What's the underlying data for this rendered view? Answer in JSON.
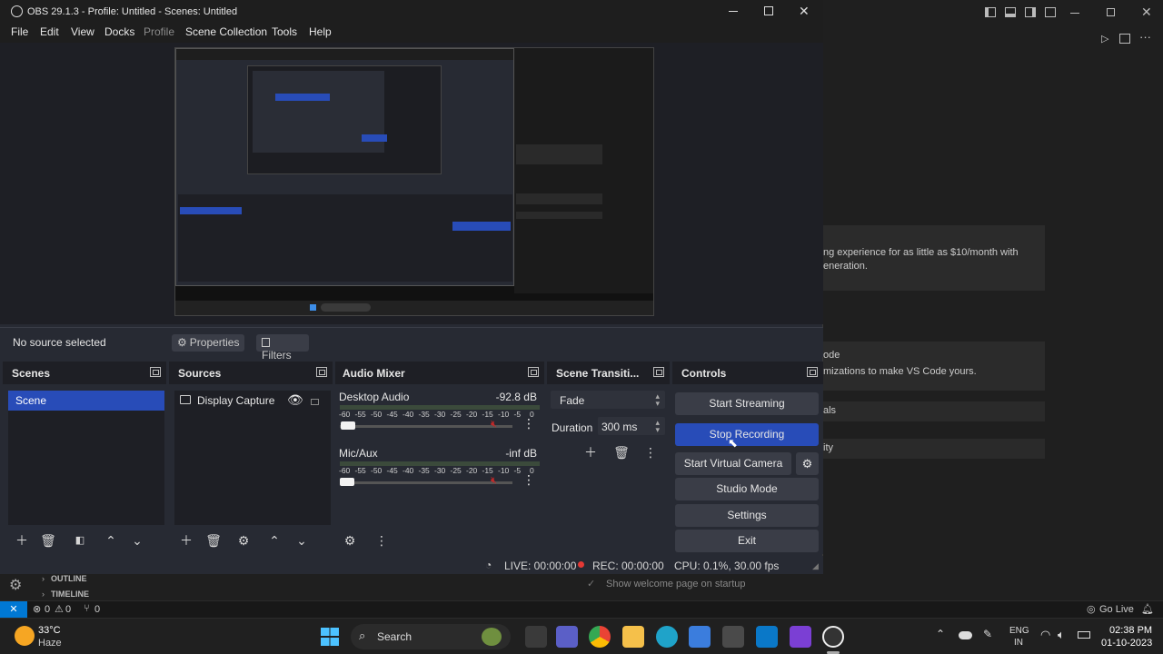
{
  "vscode": {
    "cards": [
      {
        "line1": "ng experience for as little as $10/month with",
        "line2": "eneration."
      },
      {
        "line1": "ode",
        "line2": "mizations to make VS Code yours."
      }
    ],
    "strips": [
      "als",
      "ity"
    ],
    "sidebar": {
      "outline": "OUTLINE",
      "timeline": "TIMELINE"
    },
    "welcome_checkbox_label": "Show welcome page on startup",
    "statusbar": {
      "errors": "0",
      "warnings": "0",
      "ports": "0",
      "go_live": "Go Live"
    }
  },
  "obs": {
    "title": "OBS 29.1.3 - Profile: Untitled - Scenes: Untitled",
    "menu": [
      "File",
      "Edit",
      "View",
      "Docks",
      "Profile",
      "Scene Collection",
      "Tools",
      "Help"
    ],
    "source_bar": {
      "status": "No source selected",
      "properties": "Properties",
      "filters": "Filters"
    },
    "scenes": {
      "title": "Scenes",
      "items": [
        "Scene"
      ]
    },
    "sources": {
      "title": "Sources",
      "items": [
        "Display Capture"
      ]
    },
    "mixer": {
      "title": "Audio Mixer",
      "tracks": [
        {
          "name": "Desktop Audio",
          "level": "-92.8 dB",
          "volume": 0.05
        },
        {
          "name": "Mic/Aux",
          "level": "-inf dB",
          "volume": 0.04
        }
      ],
      "scale": [
        "-60",
        "-55",
        "-50",
        "-45",
        "-40",
        "-35",
        "-30",
        "-25",
        "-20",
        "-15",
        "-10",
        "-5",
        "0"
      ]
    },
    "transitions": {
      "title": "Scene Transiti...",
      "selected": "Fade",
      "duration_label": "Duration",
      "duration_value": "300 ms"
    },
    "controls": {
      "title": "Controls",
      "buttons": [
        "Start Streaming",
        "Stop Recording",
        "Start Virtual Camera",
        "Studio Mode",
        "Settings",
        "Exit"
      ]
    },
    "status": {
      "live": "LIVE: 00:00:00",
      "rec": "REC: 00:00:00",
      "cpu": "CPU: 0.1%, 30.00 fps"
    }
  },
  "taskbar": {
    "weather_temp": "33°C",
    "weather_desc": "Haze",
    "search": "Search",
    "lang1": "ENG",
    "lang2": "IN",
    "time": "02:38 PM",
    "date": "01-10-2023"
  },
  "colors": {
    "accent": "#284cb8",
    "rec": "#e53935",
    "vscode_blue": "#0078d4"
  }
}
